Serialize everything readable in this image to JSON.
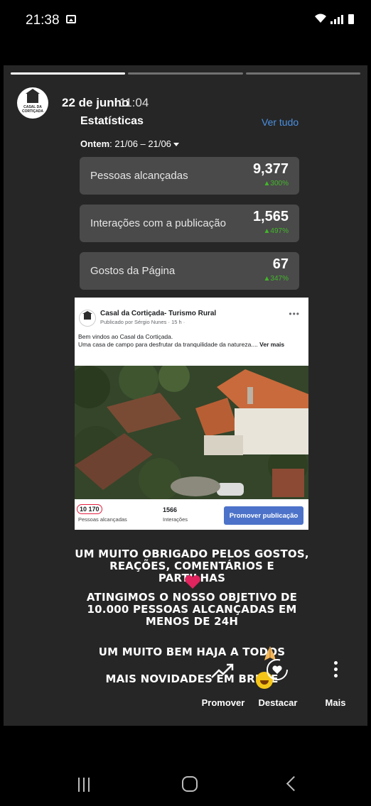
{
  "status_bar": {
    "time": "21:38"
  },
  "story": {
    "progress": [
      1.0,
      0.0,
      0.0
    ],
    "date": "22 de junho",
    "time": "11:04",
    "avatar_text": "CASAL DA CORTIÇADA"
  },
  "insights": {
    "title": "Estatísticas",
    "see_all": "Ver tudo",
    "range_label": "Ontem",
    "range_dates": ": 21/06 – 21/06",
    "stats": [
      {
        "label": "Pessoas alcançadas",
        "value": "9,377",
        "change": "300%"
      },
      {
        "label": "Interações com a publicação",
        "value": "1,565",
        "change": "497%"
      },
      {
        "label": "Gostos da Página",
        "value": "67",
        "change": "347%"
      }
    ]
  },
  "post": {
    "page_name": "Casal da Cortiçada- Turismo Rural",
    "published_by": "Publicado por Sérgio Nunes",
    "published_time": "· 15 h ·",
    "text_line1": "Bem vindos ao Casal da Cortiçada.",
    "text_line2": "Uma casa de campo para desfrutar da tranquilidade da natureza....",
    "see_more": "Ver mais",
    "reach_value": "10 170",
    "reach_label": "Pessoas alcançadas",
    "interactions_value": "1566",
    "interactions_label": "Interações",
    "promote_button": "Promover publicação"
  },
  "caption": {
    "line1": "UM MUITO OBRIGADO PELOS GOSTOS,",
    "line2": "REAÇÕES, COMENTÁRIOS E PARTILHAS",
    "line3": "ATINGIMOS O NOSSO OBJETIVO DE",
    "line4": "10.000 PESSOAS ALCANÇADAS EM",
    "line5": "MENOS DE 24H",
    "line6": "UM MUITO BEM HAJA A TODOS",
    "line7": "MAIS NOVIDADES EM BREVE"
  },
  "actions": {
    "promote": "Promover",
    "highlight": "Destacar",
    "more": "Mais"
  },
  "icons": {
    "status": [
      "image-notification-icon",
      "wifi-icon",
      "signal-icon",
      "battery-icon"
    ],
    "actions": [
      "trend-up-icon",
      "heart-circle-icon",
      "more-vertical-icon"
    ],
    "emoji": [
      "red-heart-icon",
      "folded-hands-icon",
      "laughing-face-icon"
    ],
    "nav": [
      "recent-apps-icon",
      "home-icon",
      "back-icon"
    ]
  },
  "colors": {
    "story_bg": "#262626",
    "card_bg": "#4a4a4a",
    "link_blue": "#4a90e2",
    "growth_green": "#42b72a",
    "promote_blue": "#4c73c9",
    "reach_circle": "#e41e3f"
  }
}
